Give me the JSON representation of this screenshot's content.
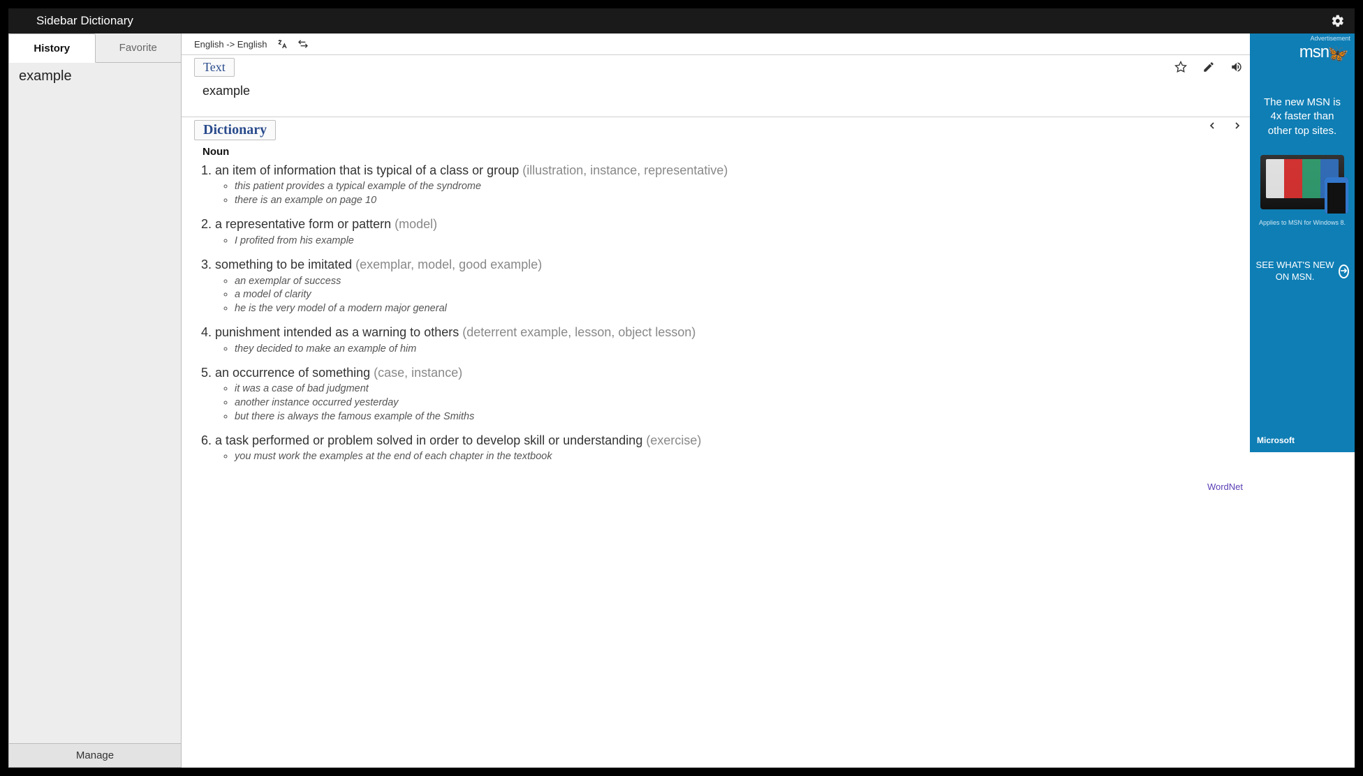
{
  "titlebar": {
    "title": "Sidebar Dictionary"
  },
  "sidebar": {
    "tabs": {
      "history": "History",
      "favorite": "Favorite"
    },
    "history_items": [
      "example"
    ],
    "manage_label": "Manage"
  },
  "lang": {
    "pair": "English -> English"
  },
  "text_section": {
    "label": "Text",
    "word": "example"
  },
  "dict_section": {
    "label": "Dictionary",
    "part_of_speech": "Noun",
    "source": "WordNet",
    "definitions": [
      {
        "def": "an item of information that is typical of a class or group",
        "syn": "(illustration, instance, representative)",
        "examples": [
          "this patient provides a typical example of the syndrome",
          "there is an example on page 10"
        ]
      },
      {
        "def": "a representative form or pattern",
        "syn": "(model)",
        "examples": [
          "I profited from his example"
        ]
      },
      {
        "def": "something to be imitated",
        "syn": "(exemplar, model, good example)",
        "examples": [
          "an exemplar of success",
          "a model of clarity",
          "he is the very model of a modern major general"
        ]
      },
      {
        "def": "punishment intended as a warning to others",
        "syn": "(deterrent example, lesson, object lesson)",
        "examples": [
          "they decided to make an example of him"
        ]
      },
      {
        "def": "an occurrence of something",
        "syn": "(case, instance)",
        "examples": [
          "it was a case of bad judgment",
          "another instance occurred yesterday",
          "but there is always the famous example of the Smiths"
        ]
      },
      {
        "def": "a task performed or problem solved in order to develop skill or understanding",
        "syn": "(exercise)",
        "examples": [
          "you must work the examples at the end of each chapter in the textbook"
        ]
      }
    ]
  },
  "ad": {
    "label": "Advertisement",
    "logo": "msn",
    "tagline": "The new MSN is 4x faster than other top sites.",
    "fineprint": "Applies to MSN for Windows 8.",
    "cta": "SEE WHAT'S NEW ON MSN.",
    "footer": "Microsoft"
  }
}
